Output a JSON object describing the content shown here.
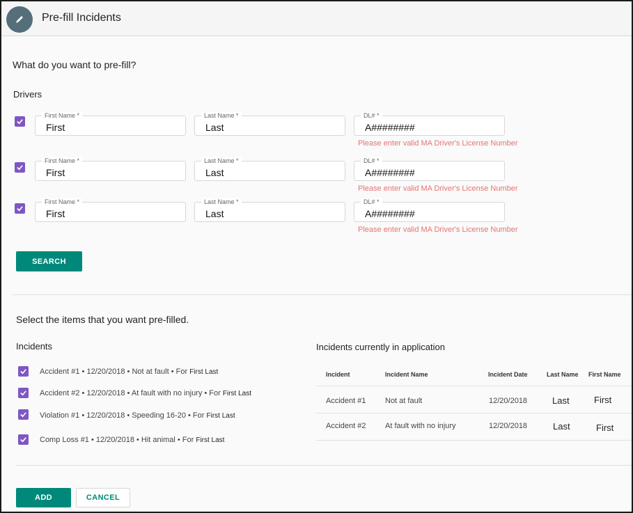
{
  "header": {
    "title": "Pre-fill Incidents",
    "icon": "pencil-icon",
    "avatar_color": "#546e7a"
  },
  "question": "What do you want to pre-fill?",
  "drivers": {
    "section_label": "Drivers",
    "rows": [
      {
        "checked": true,
        "first_label": "First Name *",
        "first_value": "First",
        "last_label": "Last Name *",
        "last_value": "Last",
        "dl_label": "DL# *",
        "dl_value": "A########",
        "error": "Please enter valid MA Driver's License Number"
      },
      {
        "checked": true,
        "first_label": "First Name *",
        "first_value": "First",
        "last_label": "Last Name *",
        "last_value": "Last",
        "dl_label": "DL# *",
        "dl_value": "A########",
        "error": "Please enter valid MA Driver's License Number"
      },
      {
        "checked": true,
        "first_label": "First Name *",
        "first_value": "First",
        "last_label": "Last Name *",
        "last_value": "Last",
        "dl_label": "DL# *",
        "dl_value": "A########",
        "error": "Please enter valid MA Driver's License Number"
      }
    ],
    "search_label": "SEARCH"
  },
  "select_title": "Select the items that you want pre-filled.",
  "incidents": {
    "section_label": "Incidents",
    "items": [
      {
        "checked": true,
        "text": "Accident #1  •  12/20/2018  •  Not at fault  •  For",
        "who": "First Last"
      },
      {
        "checked": true,
        "text": "Accident #2  •  12/20/2018  • At fault with no injury  •  For",
        "who": "First Last"
      },
      {
        "checked": true,
        "text": "Violation #1  •  12/20/2018  •  Speeding 16-20  •  For",
        "who": "First Last"
      },
      {
        "checked": true,
        "text": "Comp Loss #1  •  12/20/2018  •  Hit animal  •  For",
        "who": "First Last"
      }
    ]
  },
  "current": {
    "section_label": "Incidents currently in application",
    "headers": [
      "Incident",
      "Incident Name",
      "Incident Date",
      "Last Name",
      "First Name"
    ],
    "rows": [
      [
        "Accident #1",
        "Not at fault",
        "12/20/2018",
        "Last",
        "First"
      ],
      [
        "Accident #2",
        "At fault with no injury",
        "12/20/2018",
        "Last",
        "First"
      ]
    ]
  },
  "actions": {
    "add_label": "ADD",
    "cancel_label": "CANCEL"
  },
  "colors": {
    "accent": "#00897b",
    "checkbox": "#7e57c2",
    "error": "#e57373"
  }
}
